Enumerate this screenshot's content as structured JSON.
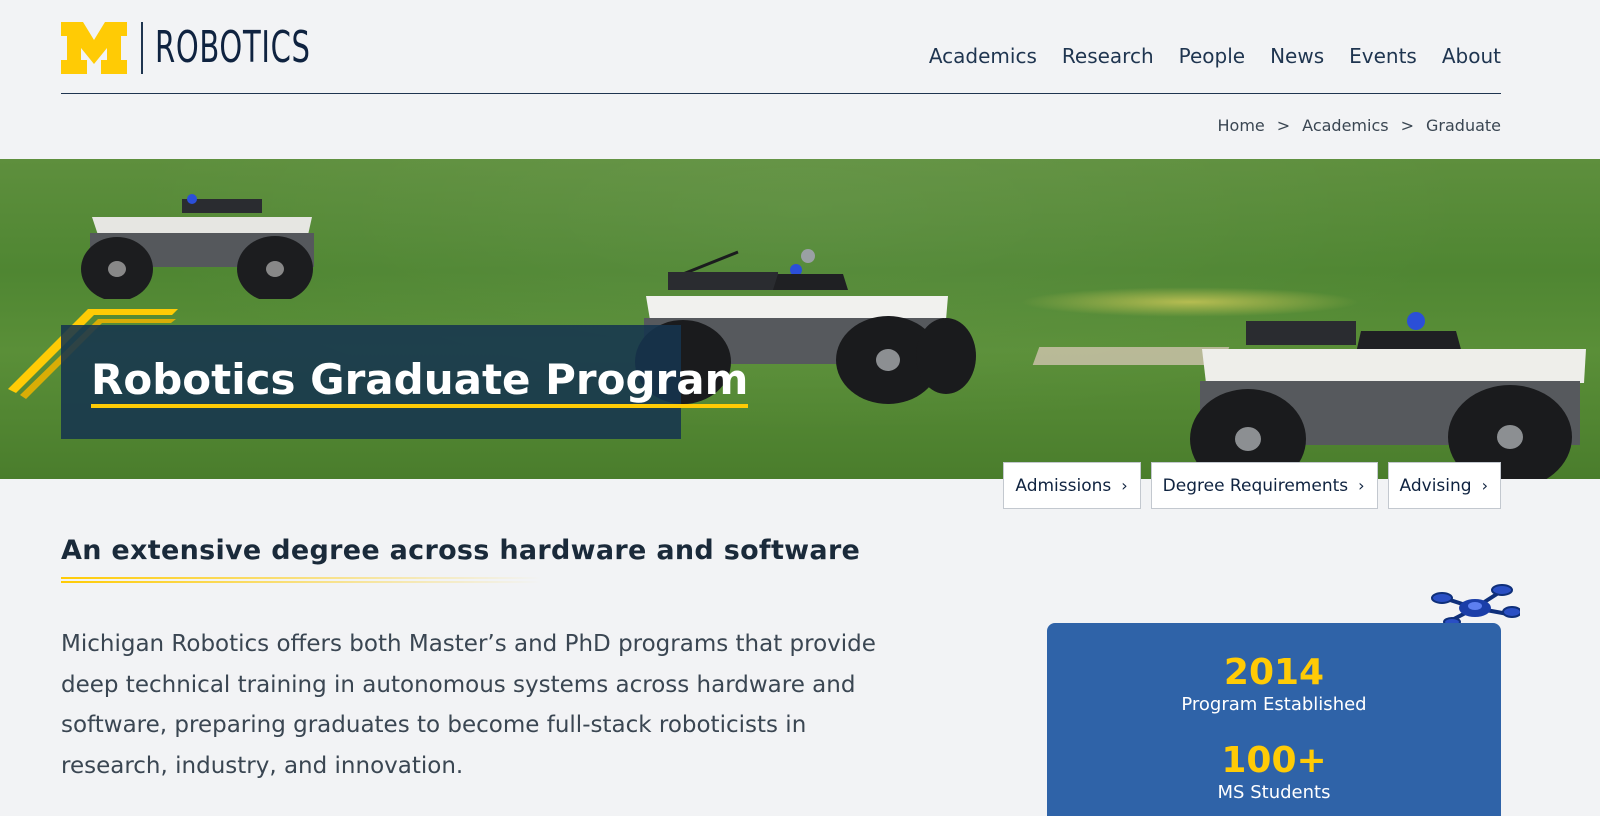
{
  "header": {
    "logo_text": "ROBOTICS",
    "nav": [
      "Academics",
      "Research",
      "People",
      "News",
      "Events",
      "About"
    ]
  },
  "breadcrumb": {
    "items": [
      "Home",
      "Academics",
      "Graduate"
    ],
    "separator": ">"
  },
  "hero": {
    "title": "Robotics Graduate Program"
  },
  "quick_links": [
    {
      "label": "Admissions",
      "chevron": "›"
    },
    {
      "label": "Degree Requirements",
      "chevron": "›"
    },
    {
      "label": "Advising",
      "chevron": "›"
    }
  ],
  "main": {
    "section_title": "An extensive degree across hardware and software",
    "intro": "Michigan Robotics offers both Master’s and PhD programs that provide deep technical training in autonomous systems across hardware and software, preparing graduates to become full-stack roboticists in research, industry, and innovation."
  },
  "stats": [
    {
      "value": "2014",
      "label": "Program Established"
    },
    {
      "value": "100+",
      "label": "MS Students"
    }
  ],
  "colors": {
    "maize": "#ffcb05",
    "blue": "#0f2340",
    "stats_card": "#2f63a8",
    "title_box": "#16344e"
  },
  "icons": [
    "block-m-logo",
    "drone-icon",
    "chevron-right-icon"
  ]
}
